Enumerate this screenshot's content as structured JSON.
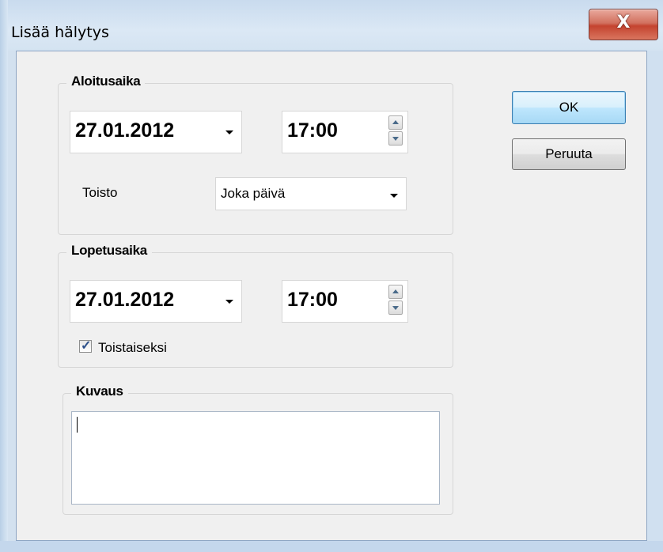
{
  "window": {
    "title": "Lisää hälytys",
    "close_glyph": "X"
  },
  "start": {
    "legend": "Aloitusaika",
    "date": "27.01.2012",
    "time": "17:00",
    "repeat_label": "Toisto",
    "repeat_value": "Joka päivä"
  },
  "end": {
    "legend": "Lopetusaika",
    "date": "27.01.2012",
    "time": "17:00",
    "until_further_label": "Toistaiseksi",
    "until_further_checked": true
  },
  "description": {
    "legend": "Kuvaus",
    "value": ""
  },
  "buttons": {
    "ok": "OK",
    "cancel": "Peruuta"
  }
}
